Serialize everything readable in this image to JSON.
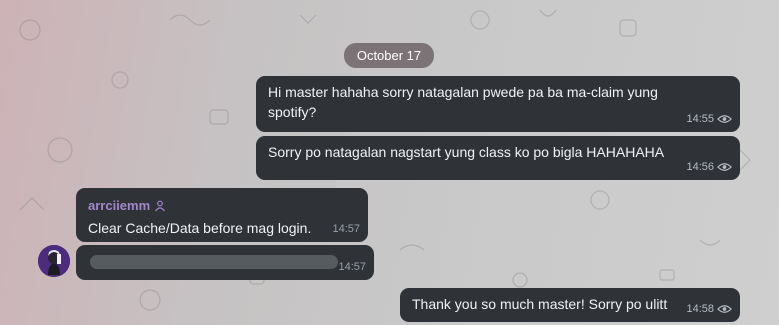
{
  "chat": {
    "date_label": "October 17",
    "messages": [
      {
        "direction": "outgoing",
        "lines": [
          "Hi master hahaha sorry natagalan pwede pa ba ma-claim yung",
          "spotify?"
        ],
        "time": "14:55"
      },
      {
        "direction": "outgoing",
        "lines": [
          "Sorry po natagalan nagstart yung class ko po bigla HAHAHAHA"
        ],
        "time": "14:56"
      },
      {
        "direction": "incoming",
        "sender": "arrciiemm",
        "lines": [
          "Clear Cache/Data before mag login."
        ],
        "time": "14:57"
      },
      {
        "direction": "incoming",
        "redacted": true,
        "time": "14:57"
      },
      {
        "direction": "outgoing",
        "lines": [
          "Thank you so much master! Sorry po ulitt"
        ],
        "time": "14:58"
      }
    ]
  },
  "colors": {
    "bubble": "#2f3338",
    "sender_name": "#a286cc",
    "date_pill": "#6e6468"
  },
  "icons": {
    "read_receipt": "eye-icon",
    "sender_badge": "person-badge-icon"
  }
}
